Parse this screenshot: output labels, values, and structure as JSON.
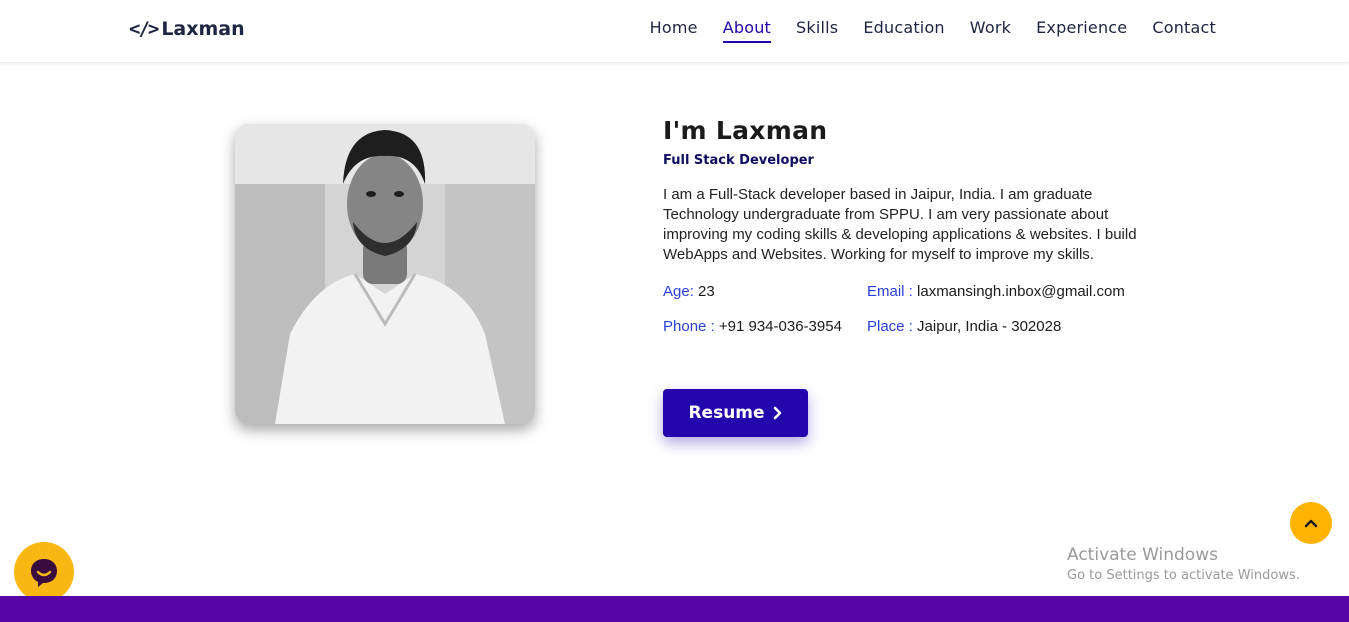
{
  "header": {
    "logo_text": "Laxman",
    "logo_icon": "code-icon",
    "nav": [
      {
        "label": "Home",
        "active": false
      },
      {
        "label": "About",
        "active": true
      },
      {
        "label": "Skills",
        "active": false
      },
      {
        "label": "Education",
        "active": false
      },
      {
        "label": "Work",
        "active": false
      },
      {
        "label": "Experience",
        "active": false
      },
      {
        "label": "Contact",
        "active": false
      }
    ]
  },
  "about": {
    "name": "I'm Laxman",
    "role": "Full Stack Developer",
    "bio": "I am a Full-Stack developer based in Jaipur, India. I am graduate Technology undergraduate from SPPU. I am very passionate about improving my coding skills & developing applications & websites. I build WebApps and Websites. Working for myself to improve my skills.",
    "age_label": "Age:",
    "age_value": "23",
    "email_label": "Email :",
    "email_value": "laxmansingh.inbox@gmail.com",
    "phone_label": "Phone :",
    "phone_value": "+91 934-036-3954",
    "place_label": "Place :",
    "place_value": "Jaipur, India - 302028",
    "resume_label": "Resume"
  },
  "watermark": {
    "title": "Activate Windows",
    "subtitle": "Go to Settings to activate Windows."
  },
  "colors": {
    "accent": "#2506ad",
    "footer": "#5706a5",
    "scroll_button": "#ffb200",
    "chat_button": "#f9b714"
  }
}
